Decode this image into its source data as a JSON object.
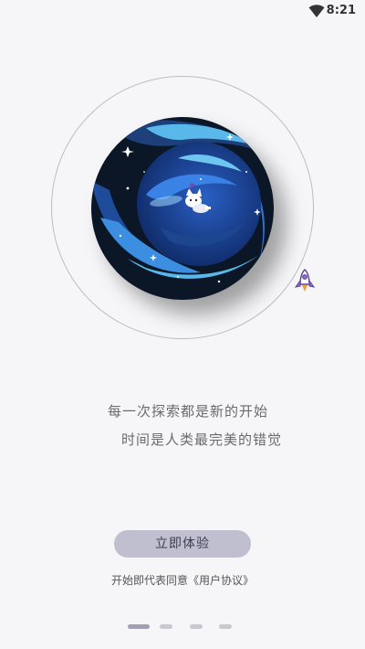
{
  "status_bar": {
    "time": "8:21",
    "icons": [
      "wifi-icon"
    ]
  },
  "hero": {
    "illustration": "planet-with-astronaut-cat",
    "orbit_object": "rocket-icon"
  },
  "slogan": {
    "line1": "每一次探索都是新的开始",
    "line2": "时间是人类最完美的错觉"
  },
  "start_button": {
    "label": "立即体验"
  },
  "agreement": {
    "prefix": "开始即代表同意",
    "link": "《用户协议》"
  },
  "pager": {
    "total": 4,
    "current": 1
  },
  "colors": {
    "background": "#f6f6f8",
    "button": "#bfbfd0",
    "planet_dark": "#0b1626",
    "planet_blue": "#2e6fd6",
    "planet_light": "#6ec6f0"
  }
}
